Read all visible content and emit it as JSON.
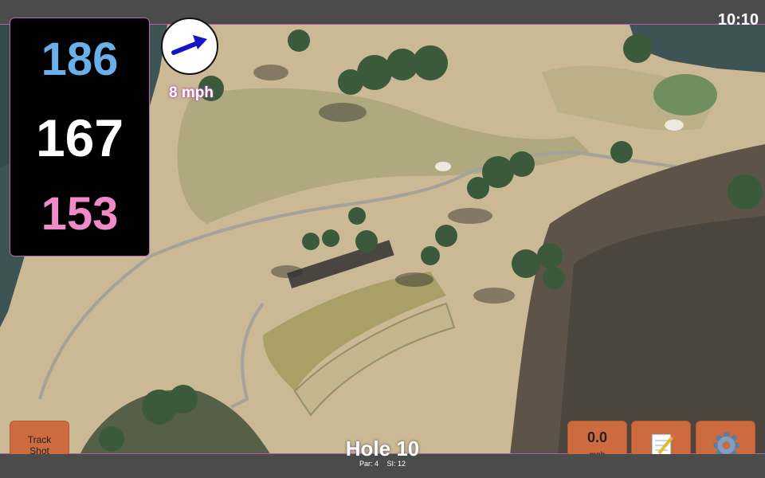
{
  "status": {
    "time": "10:10"
  },
  "distances": {
    "back": "186",
    "center": "167",
    "front": "153",
    "back_color": "#6aaeea",
    "center_color": "#ffffff",
    "front_color": "#f08ac8"
  },
  "wind": {
    "speed": "8 mph",
    "direction_icon": "wind-arrow-icon",
    "arrow_color": "#1515c8"
  },
  "buttons": {
    "track_shot": "Track\nShot",
    "speed_value": "0.0",
    "speed_unit": "mph",
    "notes_icon": "notepad-icon",
    "settings_icon": "gear-icon"
  },
  "hole": {
    "title": "Hole 10",
    "par": "Par: 4",
    "si": "SI: 12"
  },
  "colors": {
    "accent": "#cd6a3e",
    "frame": "#b060a8",
    "panel": "#000000"
  }
}
